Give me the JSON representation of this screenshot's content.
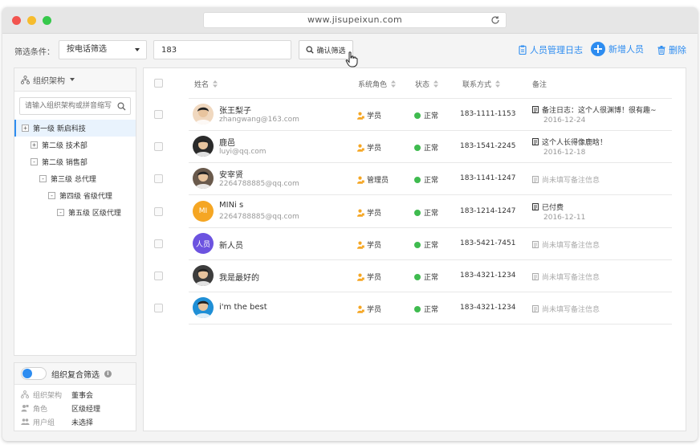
{
  "browser": {
    "url": "www.jisupeixun.com"
  },
  "filter": {
    "label": "筛选条件：",
    "select_value": "按电话筛选",
    "input_value": "183",
    "confirm_label": "确认筛选"
  },
  "actions": {
    "log_label": "人员管理日志",
    "add_label": "新增人员",
    "delete_label": "删除",
    "add_symbol": "+"
  },
  "org_tree": {
    "title": "组织架构",
    "search_placeholder": "请输入组织架构或拼音缩写",
    "nodes": [
      {
        "label": "第一级 新启科技",
        "toggle": "+",
        "active": true
      },
      {
        "label": "第二级 技术部",
        "toggle": "+"
      },
      {
        "label": "第二级 销售部",
        "toggle": "-"
      },
      {
        "label": "第三级 总代理",
        "toggle": "-"
      },
      {
        "label": "第四级 省级代理",
        "toggle": "-"
      },
      {
        "label": "第五级 区级代理",
        "toggle": "-"
      }
    ]
  },
  "composite_filter": {
    "title": "组织复合筛选",
    "info_symbol": "i",
    "rows": [
      {
        "key": "组织架构",
        "value": "董事会",
        "icon": "org-icon"
      },
      {
        "key": "角色",
        "value": "区级经理",
        "icon": "role-icon"
      },
      {
        "key": "用户组",
        "value": "未选择",
        "icon": "group-icon"
      }
    ]
  },
  "table": {
    "headers": {
      "name": "姓名",
      "role": "系统角色",
      "status": "状态",
      "contact": "联系方式",
      "note": "备注"
    },
    "rows": [
      {
        "name": "张王梨子",
        "email": "zhangwang@163.com",
        "avatar": "photo",
        "avatar_text": "",
        "avatar_color": "#f0d8bf",
        "role": "学员",
        "status": "正常",
        "phone": "183-1111-1153",
        "note": "备注日志：这个人很渊博！很有趣~",
        "note_date": "2016-12-24",
        "note_empty": false
      },
      {
        "name": "鹿邑",
        "email": "luyi@qq.com",
        "avatar": "photo",
        "avatar_text": "",
        "avatar_color": "#2b2b2b",
        "role": "学员",
        "status": "正常",
        "phone": "183-1541-2245",
        "note": "这个人长得像鹿晗！",
        "note_date": "2016-12-18",
        "note_empty": false
      },
      {
        "name": "安宰贤",
        "email": "2264788885@qq.com",
        "avatar": "photo",
        "avatar_text": "",
        "avatar_color": "#6a5a4c",
        "role": "管理员",
        "status": "正常",
        "phone": "183-1141-1247",
        "note": "尚未填写备注信息",
        "note_date": "",
        "note_empty": true
      },
      {
        "name": "MINi s",
        "email": "2264788885@qq.com",
        "avatar": "text",
        "avatar_text": "MI",
        "avatar_color": "#f5a623",
        "role": "学员",
        "status": "正常",
        "phone": "183-1214-1247",
        "note": "已付费",
        "note_date": "2016-12-11",
        "note_empty": false
      },
      {
        "name": "新人员",
        "email": "",
        "avatar": "text",
        "avatar_text": "人员",
        "avatar_color": "#6c53e0",
        "role": "学员",
        "status": "正常",
        "phone": "183-5421-7451",
        "note": "尚未填写备注信息",
        "note_date": "",
        "note_empty": true
      },
      {
        "name": "我是最好的",
        "email": "",
        "avatar": "photo",
        "avatar_text": "",
        "avatar_color": "#3d3d3d",
        "role": "学员",
        "status": "正常",
        "phone": "183-4321-1234",
        "note": "尚未填写备注信息",
        "note_date": "",
        "note_empty": true
      },
      {
        "name": "i'm the best",
        "email": "",
        "avatar": "photo",
        "avatar_text": "",
        "avatar_color": "#1f8fd6",
        "role": "学员",
        "status": "正常",
        "phone": "183-4321-1234",
        "note": "尚未填写备注信息",
        "note_date": "",
        "note_empty": true
      }
    ]
  },
  "colors": {
    "accent": "#2d8cf0",
    "status_ok": "#3fbb4f",
    "role_icon": "#f5a623",
    "text_muted": "#999999"
  }
}
